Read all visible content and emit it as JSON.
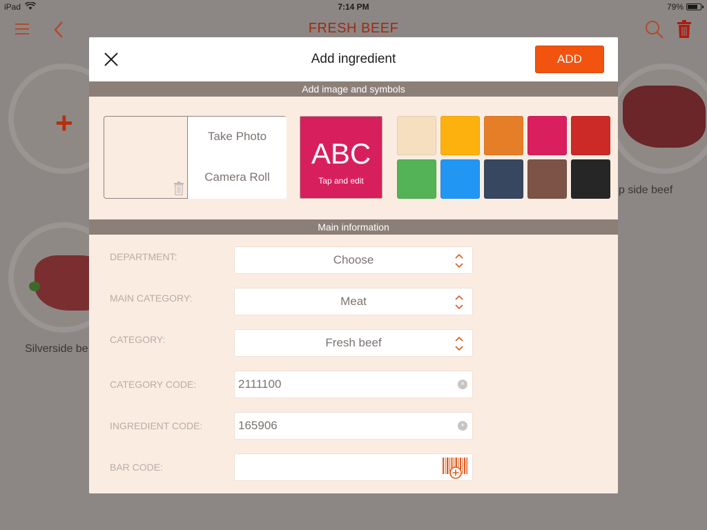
{
  "status_bar": {
    "carrier": "iPad",
    "time": "7:14 PM",
    "battery": "79%",
    "battery_level": 0.79
  },
  "nav": {
    "title": "FRESH BEEF"
  },
  "background": {
    "add_tile": {
      "symbol": "+"
    },
    "items": [
      {
        "label": "Silverside be"
      },
      {
        "label": "p side beef"
      }
    ]
  },
  "modal": {
    "title": "Add ingredient",
    "add_label": "ADD",
    "section_image": "Add image and symbols",
    "section_main": "Main information",
    "photo": {
      "take_label": "Take Photo",
      "roll_label": "Camera Roll"
    },
    "symbol_tile": {
      "text": "ABC",
      "hint": "Tap and edit",
      "color": "#d81f5e"
    },
    "swatches": [
      "#f6dfbf",
      "#fdb10f",
      "#e67e27",
      "#da1f5e",
      "#cb2a27",
      "#53b356",
      "#2196f3",
      "#36475f",
      "#7d5347",
      "#262626"
    ],
    "fields": {
      "department": {
        "label": "DEPARTMENT:",
        "value": "Choose"
      },
      "main_category": {
        "label": "MAIN CATEGORY:",
        "value": "Meat"
      },
      "category": {
        "label": "CATEGORY:",
        "value": "Fresh beef"
      },
      "category_code": {
        "label": "CATEGORY CODE:",
        "value": "2111100"
      },
      "ingredient_code": {
        "label": "INGREDIENT CODE:",
        "value": "165906"
      },
      "bar_code": {
        "label": "BAR CODE:",
        "value": ""
      }
    }
  }
}
